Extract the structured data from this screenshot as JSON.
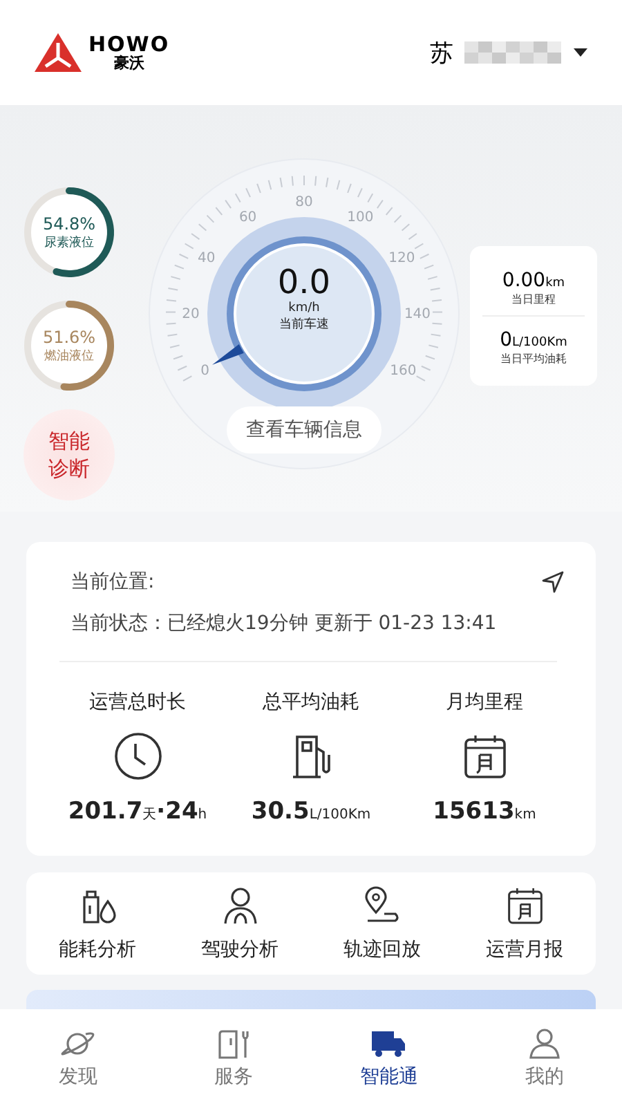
{
  "header": {
    "brand": "HOWO",
    "brand_sub": "豪沃",
    "plate": "苏"
  },
  "levels": [
    {
      "value": "54.8%",
      "label": "尿素液位",
      "color": "#1f5a57"
    },
    {
      "value": "51.6%",
      "label": "燃油液位",
      "color": "#a8865e"
    }
  ],
  "diagnosis": [
    "智能",
    "诊断"
  ],
  "speedometer": {
    "ticks": [
      "0",
      "20",
      "40",
      "60",
      "80",
      "100",
      "120",
      "140",
      "160"
    ],
    "speed": "0.0",
    "unit": "km/h",
    "label": "当前车速"
  },
  "vehicle_info_button": "查看车辆信息",
  "today": [
    {
      "value": "0.00",
      "unit": "km",
      "label": "当日里程"
    },
    {
      "value": "0",
      "unit": "L/100Km",
      "label": "当日平均油耗"
    }
  ],
  "status": {
    "location_label": "当前位置:",
    "status_line": "当前状态：已经熄火19分钟 更新于 01-23 13:41"
  },
  "stats": [
    {
      "label": "运营总时长",
      "kind": "clock",
      "value": "201.7",
      "unit": "天",
      "separator": "·",
      "value2": "24",
      "unit2": "h"
    },
    {
      "label": "总平均油耗",
      "kind": "fuel",
      "value": "30.5",
      "unit": "L/100Km"
    },
    {
      "label": "月均里程",
      "kind": "calendar",
      "value": "15613",
      "unit": "km"
    }
  ],
  "shortcuts": [
    {
      "label": "能耗分析",
      "kind": "oil"
    },
    {
      "label": "驾驶分析",
      "kind": "driver"
    },
    {
      "label": "轨迹回放",
      "kind": "route"
    },
    {
      "label": "运营月报",
      "kind": "calendar"
    }
  ],
  "tabs": [
    {
      "label": "发现",
      "kind": "planet",
      "selected": false
    },
    {
      "label": "服务",
      "kind": "service",
      "selected": false
    },
    {
      "label": "智能通",
      "kind": "truck",
      "selected": true
    },
    {
      "label": "我的",
      "kind": "user",
      "selected": false
    }
  ]
}
